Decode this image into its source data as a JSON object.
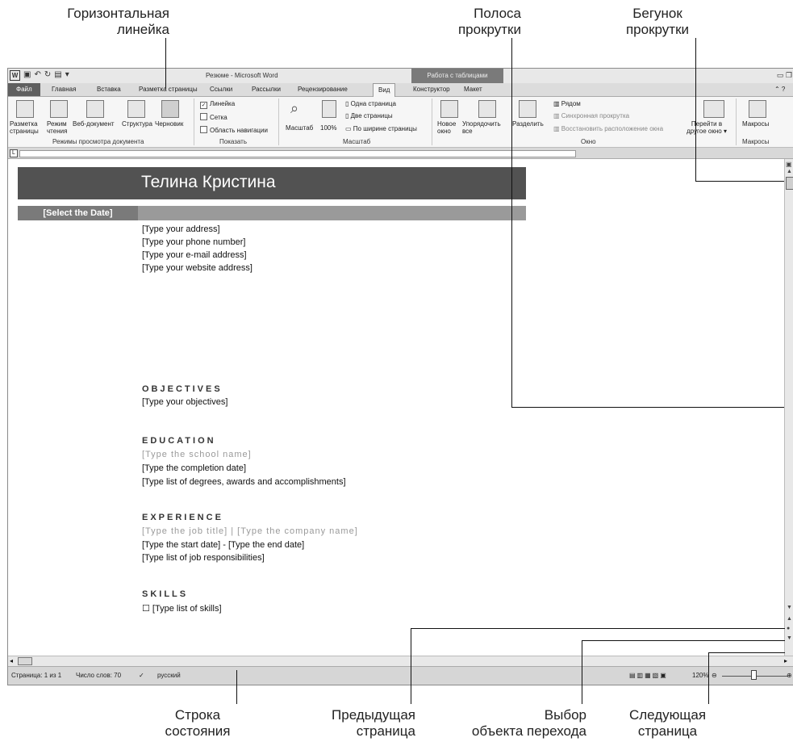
{
  "callouts": {
    "horizontal_ruler": [
      "Горизонтальная",
      "линейка"
    ],
    "scroll_bar": [
      "Полоса",
      "прокрутки"
    ],
    "scroll_thumb": [
      "Бегунок",
      "прокрутки"
    ],
    "status_bar": [
      "Строка",
      "состояния"
    ],
    "previous_page": [
      "Предыдущая",
      "страница"
    ],
    "select_browse_object": [
      "Выбор",
      "объекта перехода"
    ],
    "next_page": [
      "Следующая",
      "страница"
    ]
  },
  "window": {
    "title": "Резюме - Microsoft Word",
    "context_tab_group": "Работа с таблицами",
    "word_icon": "W"
  },
  "tabs": [
    "Файл",
    "Главная",
    "Вставка",
    "Разметка страницы",
    "Ссылки",
    "Рассылки",
    "Рецензирование",
    "Вид",
    "Конструктор",
    "Макет"
  ],
  "ribbon": {
    "views": {
      "print_layout": [
        "Разметка",
        "страницы"
      ],
      "reading": [
        "Режим",
        "чтения"
      ],
      "web": "Веб-документ",
      "outline": "Структура",
      "draft": "Черновик",
      "group": "Режимы просмотра документа"
    },
    "show": {
      "ruler": "Линейка",
      "grid": "Сетка",
      "nav_pane": "Область навигации",
      "group": "Показать"
    },
    "zoom": {
      "zoom": "Масштаб",
      "hundred": "100%",
      "one_page": "Одна страница",
      "two_pages": "Две страницы",
      "page_width": "По ширине страницы",
      "group": "Масштаб"
    },
    "window": {
      "new_window": [
        "Новое",
        "окно"
      ],
      "arrange_all": [
        "Упорядочить",
        "все"
      ],
      "split": "Разделить",
      "side_by_side": "Рядом",
      "sync_scroll": "Синхронная прокрутка",
      "reset_position": "Восстановить расположение окна",
      "switch_windows": [
        "Перейти в",
        "другое окно ▾"
      ],
      "group": "Окно"
    },
    "macros": {
      "macros": "Макросы",
      "group": "Макросы"
    }
  },
  "document": {
    "name": "Телина Кристина",
    "date": "[Select the Date]",
    "address_lines": [
      "[Type your address]",
      "[Type your phone number]",
      "[Type your e-mail address]",
      "[Type your website address]"
    ],
    "objectives_heading": "OBJECTIVES",
    "objectives_text": "[Type your objectives]",
    "education_heading": "EDUCATION",
    "school": "[Type the school name]",
    "completion": "[Type the completion date]",
    "degrees": "[Type list of degrees, awards and accomplishments]",
    "experience_heading": "EXPERIENCE",
    "job": "[Type the job title]  |  [Type the company name]",
    "dates": "[Type the start date] - [Type the end date]",
    "responsibilities": "[Type list of job responsibilities]",
    "skills_heading": "SKILLS",
    "skills": "[Type list of skills]"
  },
  "status": {
    "page": "Страница: 1 из 1",
    "words": "Число слов: 70",
    "language": "русский",
    "zoom": "120%"
  }
}
